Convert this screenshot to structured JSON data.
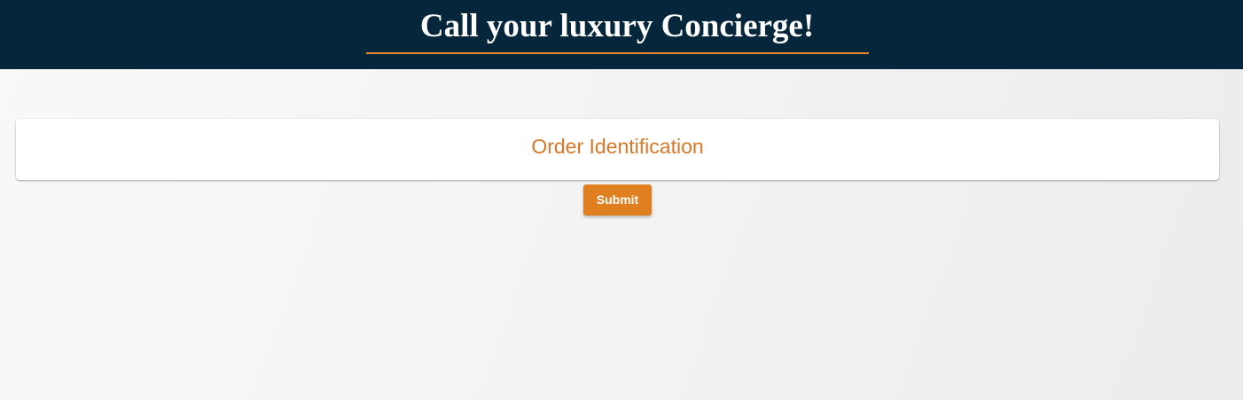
{
  "header": {
    "title": "Call your luxury Concierge!"
  },
  "card": {
    "title": "Order Identification"
  },
  "form": {
    "submit_label": "Submit"
  },
  "colors": {
    "header_bg": "#06263b",
    "accent": "#e07f20",
    "card_title": "#d8792a",
    "page_bg": "#f2f2f3"
  }
}
